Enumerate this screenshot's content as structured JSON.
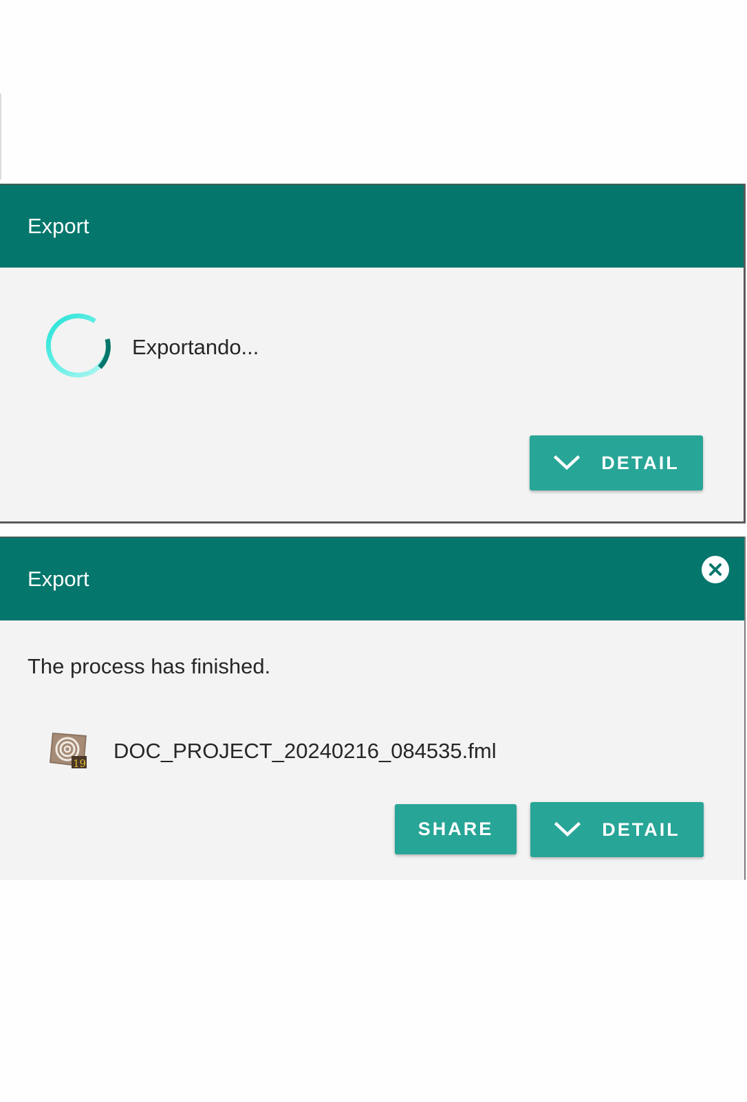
{
  "colors": {
    "header": "#04766b",
    "button": "#27a597",
    "dialog_bg": "#f3f3f3",
    "spinner_light": "#2ee3d9",
    "spinner_dark": "#04766b"
  },
  "export_progress_dialog": {
    "title": "Export",
    "progress_text": "Exportando...",
    "detail_label": "DETAIL",
    "detail_icon": "chevron-down-icon",
    "spinner_icon": "spinner-icon"
  },
  "export_finished_dialog": {
    "title": "Export",
    "close_icon": "close-icon",
    "message": "The process has finished.",
    "file": {
      "name": "DOC_PROJECT_20240216_084535.fml",
      "icon": "fml-file-icon",
      "icon_badge": "19"
    },
    "share_label": "SHARE",
    "detail_label": "DETAIL",
    "detail_icon": "chevron-down-icon"
  }
}
